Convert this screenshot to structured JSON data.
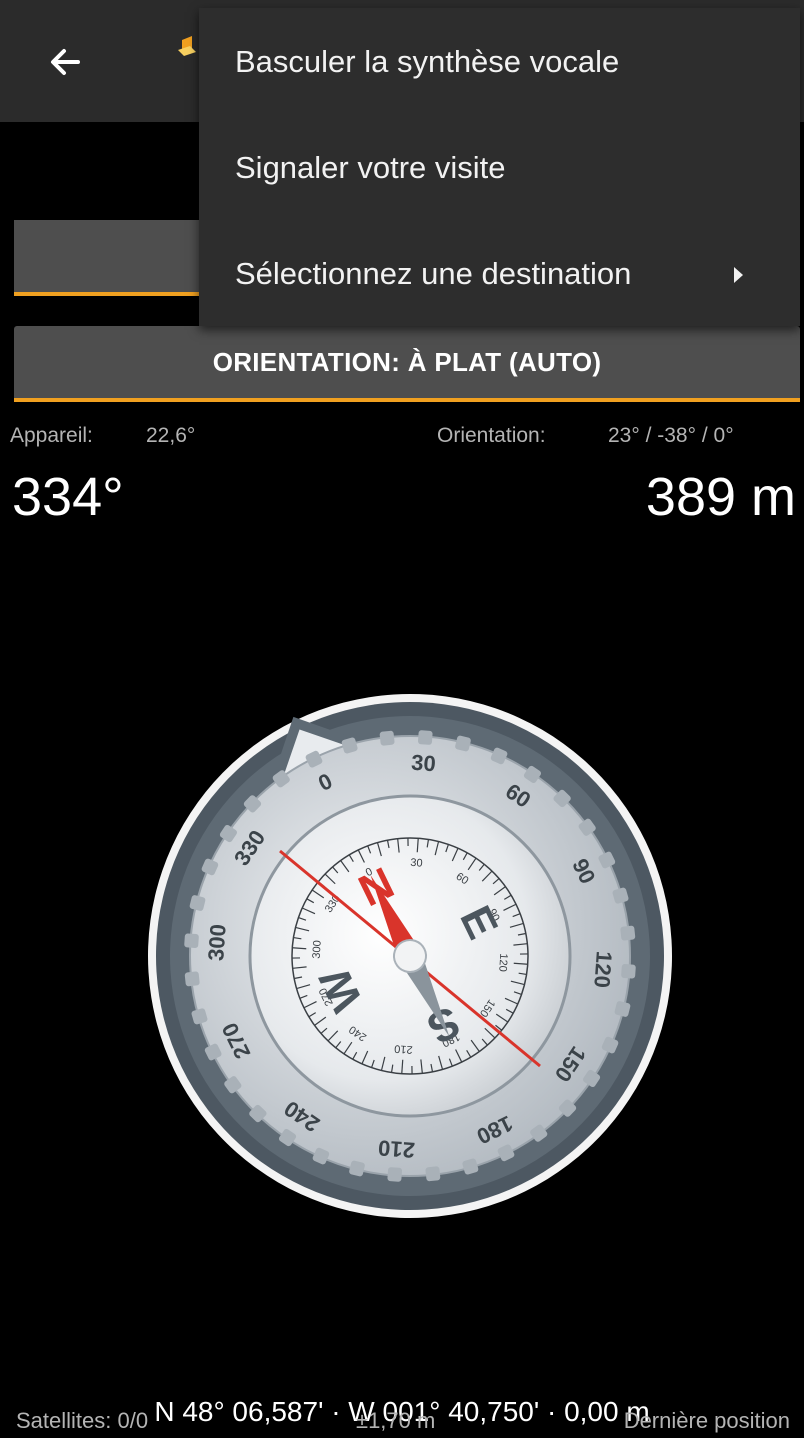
{
  "menu": {
    "items": [
      {
        "label": "Basculer la synthèse vocale"
      },
      {
        "label": "Signaler votre visite"
      },
      {
        "label": "Sélectionnez une destination"
      }
    ]
  },
  "buttons": {
    "top_label": "",
    "orientation_label": "ORIENTATION: À PLAT (AUTO)"
  },
  "readout": {
    "device_label": "Appareil:",
    "device_value": "22,6°",
    "orientation_label": "Orientation:",
    "orientation_value": "23° /  -38° /   0°",
    "heading": "334°",
    "distance": "389 m"
  },
  "compass": {
    "outer_ticks": [
      "0",
      "30",
      "60",
      "90",
      "120",
      "150",
      "180",
      "210",
      "240",
      "270",
      "300",
      "330"
    ],
    "inner_ticks": [
      "0",
      "30",
      "60",
      "90",
      "120",
      "150",
      "180",
      "210",
      "240",
      "270",
      "300",
      "330"
    ],
    "cardinals": [
      "N",
      "E",
      "S",
      "W"
    ],
    "needle_color": "#d9342b"
  },
  "footer": {
    "coordinates": "N 48° 06,587' · W 001° 40,750' · 0,00 m",
    "satellites": "Satellites: 0/0",
    "accuracy": "±1,70 m",
    "last_position": "Dernière position"
  },
  "colors": {
    "accent": "#f0a020",
    "appbar": "#2b2b2b",
    "button": "#4e4e4e"
  }
}
